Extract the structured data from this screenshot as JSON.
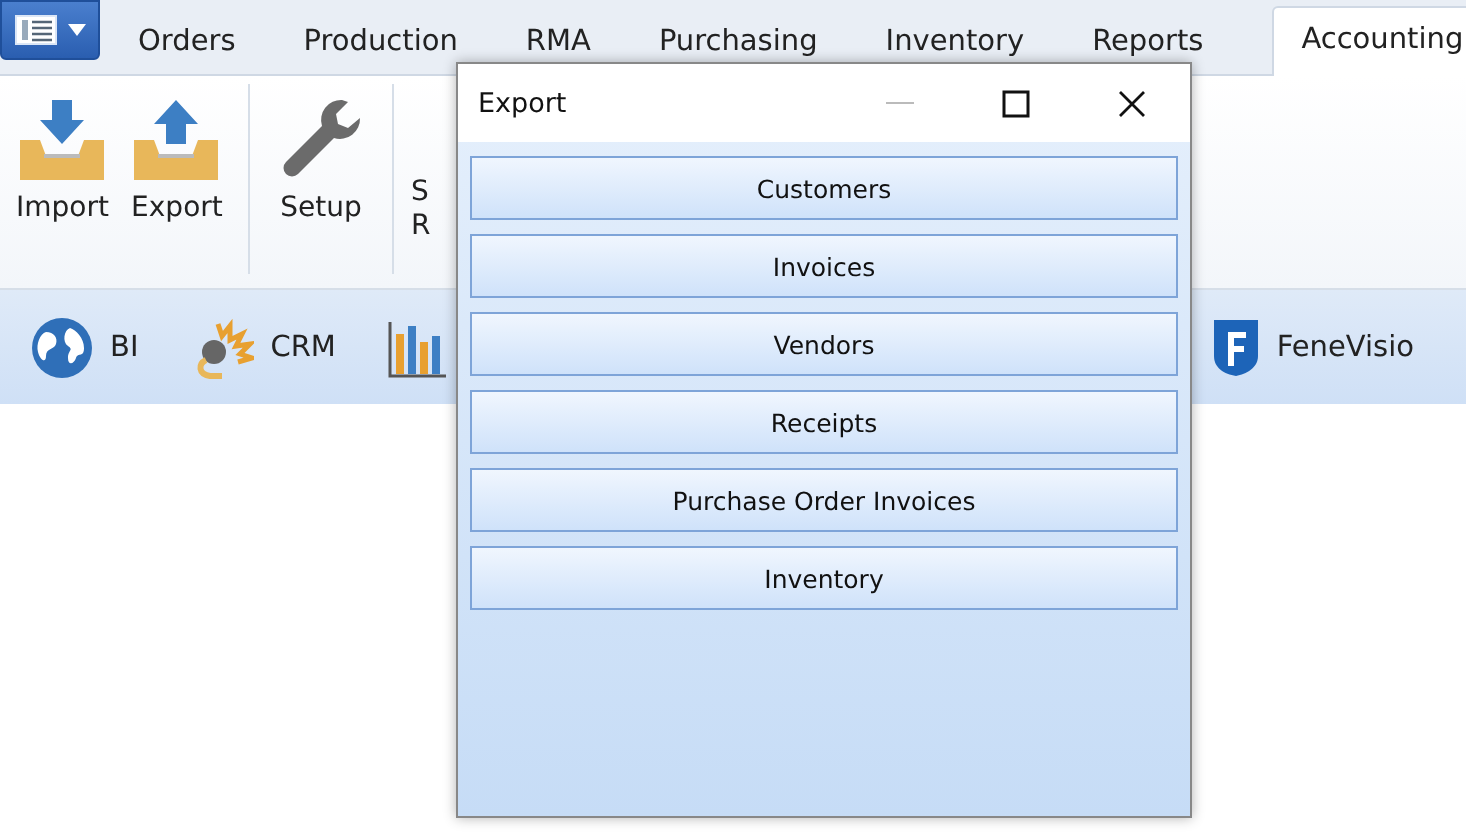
{
  "tabs": [
    {
      "label": "Orders",
      "selected": false
    },
    {
      "label": "Production",
      "selected": false
    },
    {
      "label": "RMA",
      "selected": false
    },
    {
      "label": "Purchasing",
      "selected": false
    },
    {
      "label": "Inventory",
      "selected": false
    },
    {
      "label": "Reports",
      "selected": false
    },
    {
      "label": "Accounting",
      "selected": true
    }
  ],
  "ribbon": [
    {
      "kind": "import",
      "label": "Import"
    },
    {
      "kind": "export",
      "label": "Export"
    },
    {
      "kind": "separator"
    },
    {
      "kind": "setup",
      "label": "Setup"
    },
    {
      "kind": "separator"
    },
    {
      "kind": "partial",
      "lines": [
        "S",
        "R"
      ]
    }
  ],
  "toolbar": [
    {
      "kind": "globe",
      "label": "BI"
    },
    {
      "kind": "crm",
      "label": "CRM"
    },
    {
      "kind": "chart"
    },
    {
      "kind": "spacer"
    },
    {
      "kind": "fenevision",
      "label": "FeneVisio"
    }
  ],
  "dialog": {
    "title": "Export",
    "buttons": [
      "Customers",
      "Invoices",
      "Vendors",
      "Receipts",
      "Purchase Order Invoices",
      "Inventory"
    ]
  }
}
